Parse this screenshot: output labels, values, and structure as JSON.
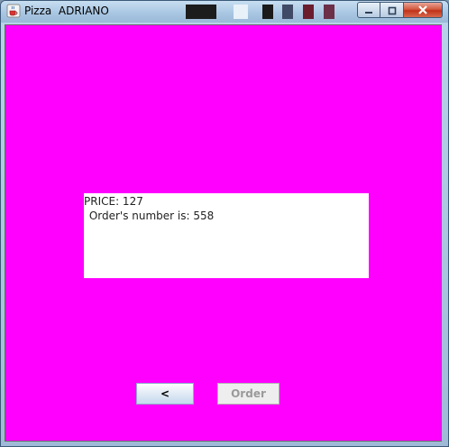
{
  "window": {
    "title": "Pizza  ADRIANO"
  },
  "panel": {
    "price_text": "PRICE: 127",
    "order_number_text": " Order's number is: 558"
  },
  "buttons": {
    "back_label": "<",
    "order_label": "Order"
  },
  "colors": {
    "background": "#ff00ff",
    "panel": "#ffffff",
    "order_disabled_text": "#9a9a9a"
  },
  "icons": {
    "app": "java-cup-icon",
    "minimize": "minimize-icon",
    "maximize": "maximize-icon",
    "close": "close-icon"
  }
}
